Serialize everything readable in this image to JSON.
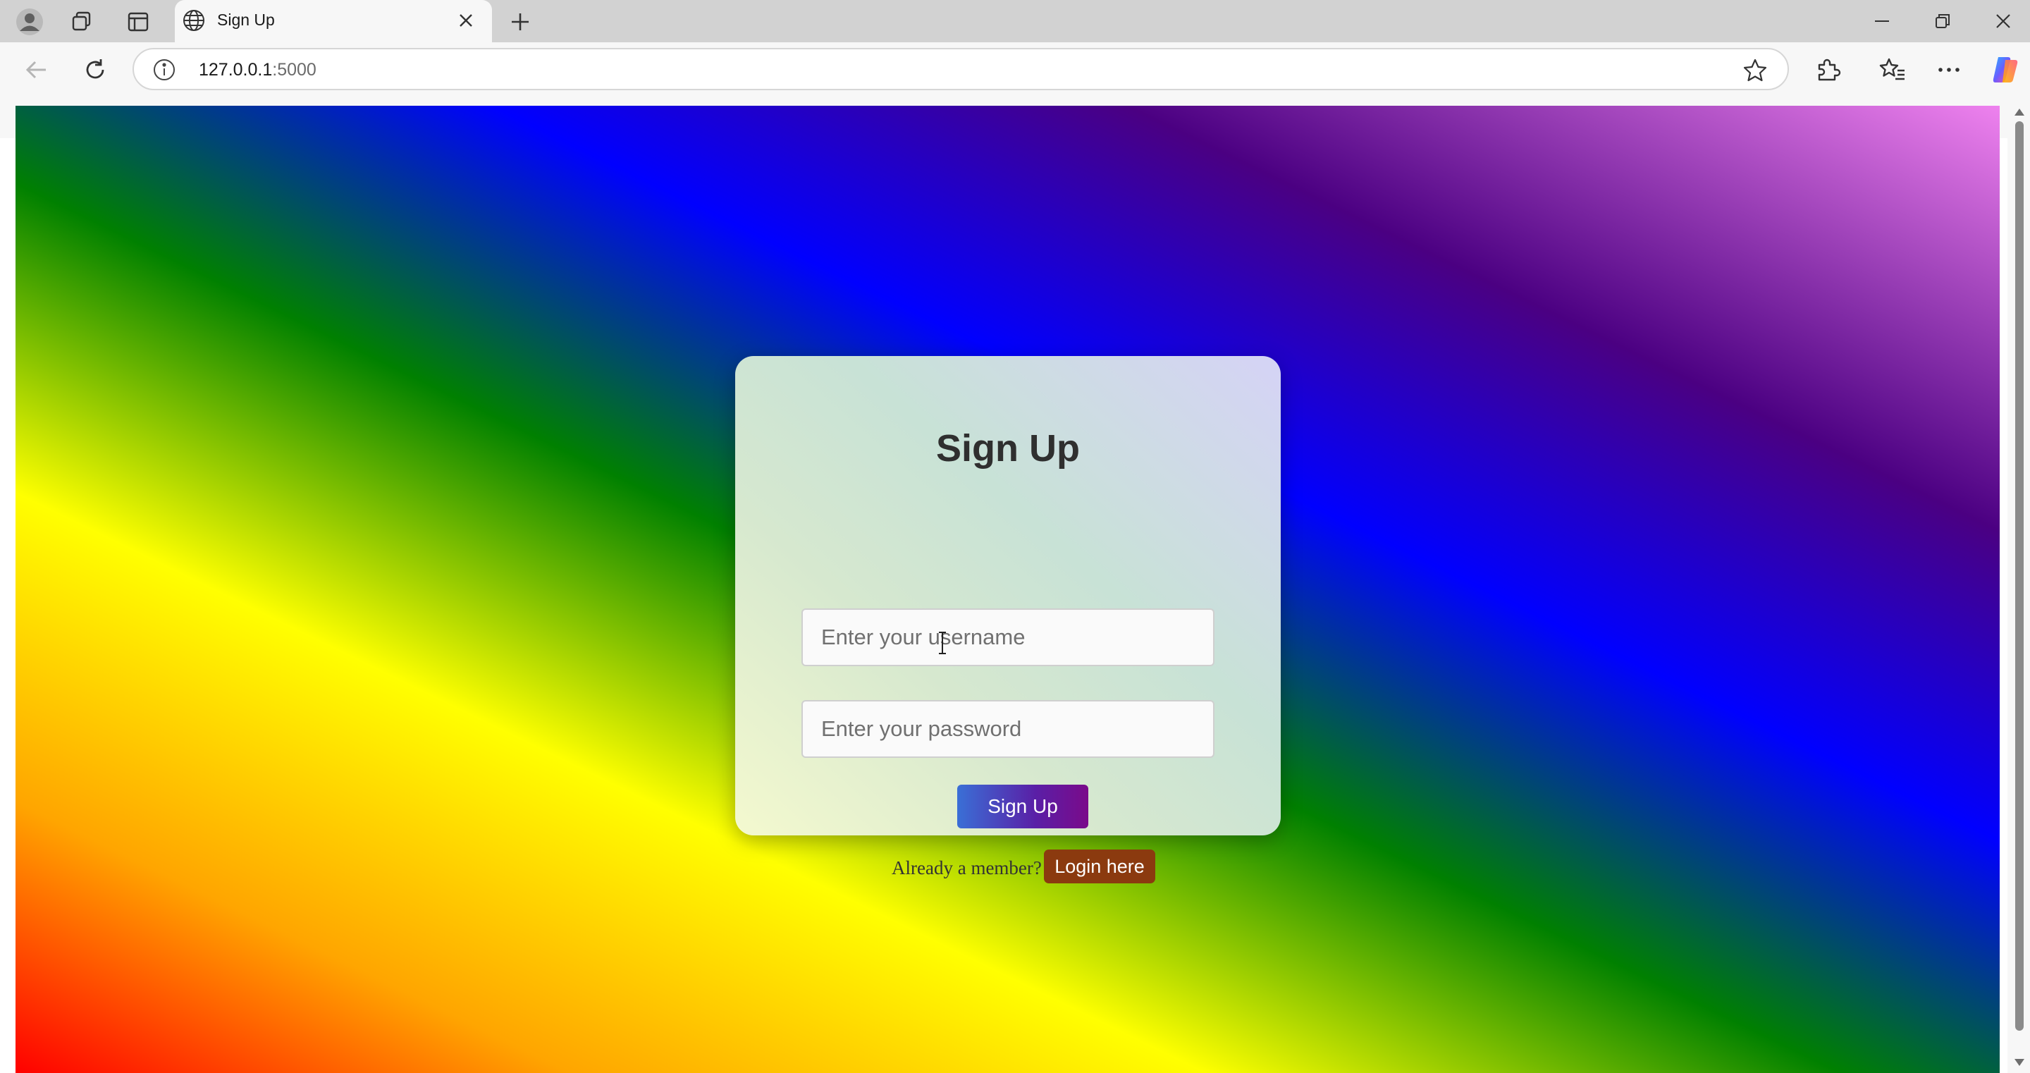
{
  "browser": {
    "tab": {
      "title": "Sign Up"
    },
    "address_bar": {
      "host": "127.0.0.1",
      "port": ":5000"
    }
  },
  "page": {
    "background_gradient": [
      "#ff0000",
      "#ffa500",
      "#ffff00",
      "#008000",
      "#0000ff",
      "#4b0082",
      "#ee82ee"
    ],
    "card": {
      "title": "Sign Up",
      "username": {
        "value": "",
        "placeholder": "Enter your username"
      },
      "password": {
        "value": "",
        "placeholder": "Enter your password"
      },
      "submit_label": "Sign Up",
      "member_prompt": "Already a member?",
      "login_label": "Login here"
    }
  },
  "colors": {
    "submit_gradient": [
      "#3a6fd6",
      "#7a0a8a"
    ],
    "login_button": "#8b3a0f"
  }
}
